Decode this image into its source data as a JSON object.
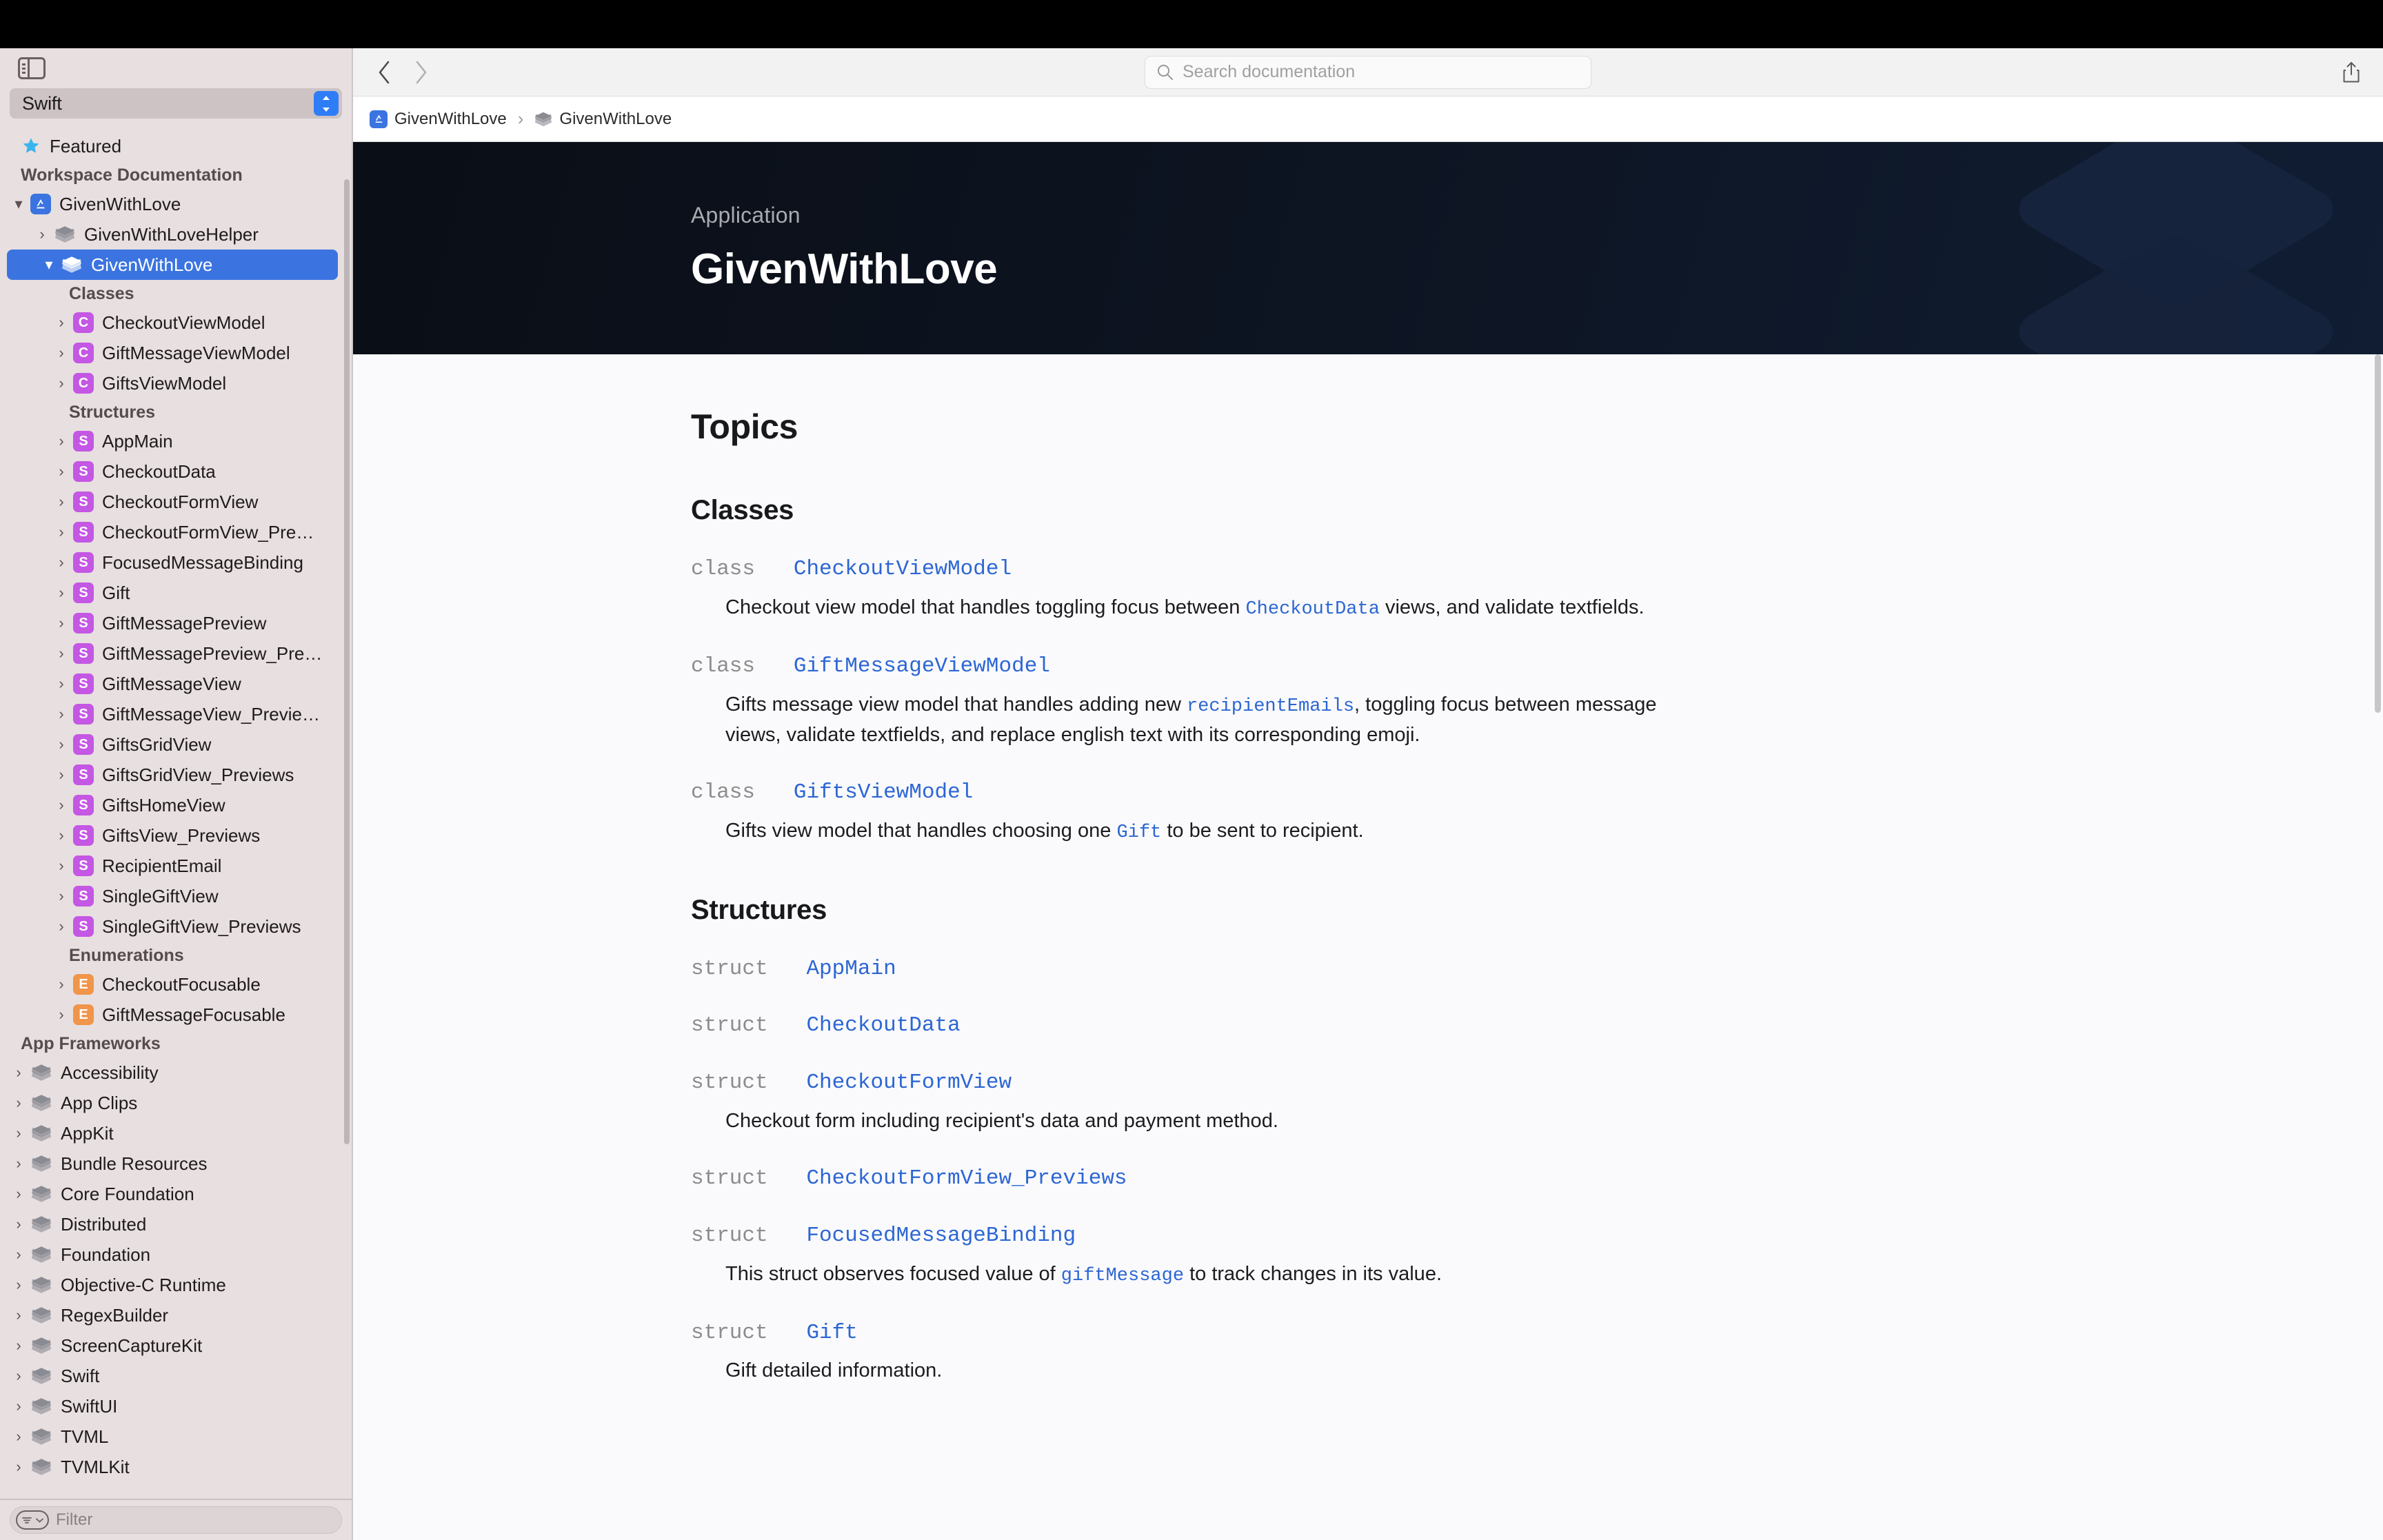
{
  "window": {
    "chrome_color": "#000000"
  },
  "sidebar": {
    "toggle_icon": "sidebar-toggle-icon",
    "language_selector": {
      "value": "Swift",
      "icon": "chevron-up-down-icon"
    },
    "featured": {
      "label": "Featured",
      "icon": "star-icon"
    },
    "groups": [
      {
        "header": "Workspace Documentation",
        "items": [
          {
            "label": "GivenWithLove",
            "icon": "app-icon",
            "disclosure": "expanded",
            "indent": 0
          },
          {
            "label": "GivenWithLoveHelper",
            "icon": "stack-icon",
            "disclosure": "collapsed",
            "indent": 1
          },
          {
            "label": "GivenWithLove",
            "icon": "stack-icon",
            "disclosure": "expanded",
            "indent": 1,
            "selected": true
          }
        ]
      }
    ],
    "subsections": [
      {
        "header": "Classes",
        "items": [
          {
            "label": "CheckoutViewModel",
            "badge": "C",
            "badge_kind": "c"
          },
          {
            "label": "GiftMessageViewModel",
            "badge": "C",
            "badge_kind": "c"
          },
          {
            "label": "GiftsViewModel",
            "badge": "C",
            "badge_kind": "c"
          }
        ]
      },
      {
        "header": "Structures",
        "items": [
          {
            "label": "AppMain",
            "badge": "S",
            "badge_kind": "s"
          },
          {
            "label": "CheckoutData",
            "badge": "S",
            "badge_kind": "s"
          },
          {
            "label": "CheckoutFormView",
            "badge": "S",
            "badge_kind": "s"
          },
          {
            "label": "CheckoutFormView_Pre…",
            "badge": "S",
            "badge_kind": "s"
          },
          {
            "label": "FocusedMessageBinding",
            "badge": "S",
            "badge_kind": "s"
          },
          {
            "label": "Gift",
            "badge": "S",
            "badge_kind": "s"
          },
          {
            "label": "GiftMessagePreview",
            "badge": "S",
            "badge_kind": "s"
          },
          {
            "label": "GiftMessagePreview_Pre…",
            "badge": "S",
            "badge_kind": "s"
          },
          {
            "label": "GiftMessageView",
            "badge": "S",
            "badge_kind": "s"
          },
          {
            "label": "GiftMessageView_Previe…",
            "badge": "S",
            "badge_kind": "s"
          },
          {
            "label": "GiftsGridView",
            "badge": "S",
            "badge_kind": "s"
          },
          {
            "label": "GiftsGridView_Previews",
            "badge": "S",
            "badge_kind": "s"
          },
          {
            "label": "GiftsHomeView",
            "badge": "S",
            "badge_kind": "s"
          },
          {
            "label": "GiftsView_Previews",
            "badge": "S",
            "badge_kind": "s"
          },
          {
            "label": "RecipientEmail",
            "badge": "S",
            "badge_kind": "s"
          },
          {
            "label": "SingleGiftView",
            "badge": "S",
            "badge_kind": "s"
          },
          {
            "label": "SingleGiftView_Previews",
            "badge": "S",
            "badge_kind": "s"
          }
        ]
      },
      {
        "header": "Enumerations",
        "items": [
          {
            "label": "CheckoutFocusable",
            "badge": "E",
            "badge_kind": "e"
          },
          {
            "label": "GiftMessageFocusable",
            "badge": "E",
            "badge_kind": "e"
          }
        ]
      }
    ],
    "frameworks": {
      "header": "App Frameworks",
      "items": [
        {
          "label": "Accessibility"
        },
        {
          "label": "App Clips"
        },
        {
          "label": "AppKit"
        },
        {
          "label": "Bundle Resources"
        },
        {
          "label": "Core Foundation"
        },
        {
          "label": "Distributed"
        },
        {
          "label": "Foundation"
        },
        {
          "label": "Objective-C Runtime"
        },
        {
          "label": "RegexBuilder"
        },
        {
          "label": "ScreenCaptureKit"
        },
        {
          "label": "Swift"
        },
        {
          "label": "SwiftUI"
        },
        {
          "label": "TVML"
        },
        {
          "label": "TVMLKit"
        }
      ]
    },
    "filter": {
      "placeholder": "Filter",
      "icon": "filter-pill-icon"
    }
  },
  "toolbar": {
    "back_icon": "chevron-left-icon",
    "forward_icon": "chevron-right-icon",
    "search": {
      "placeholder": "Search documentation",
      "icon": "search-icon"
    },
    "share_icon": "share-icon"
  },
  "breadcrumb": {
    "items": [
      {
        "label": "GivenWithLove",
        "icon": "app-icon"
      },
      {
        "label": "GivenWithLove",
        "icon": "stack-icon"
      }
    ],
    "separator": "›"
  },
  "hero": {
    "eyebrow": "Application",
    "title": "GivenWithLove",
    "decoration_icon": "stack-layers-icon",
    "gradient_from": "#0a0e16",
    "gradient_to": "#101d33"
  },
  "document": {
    "topics_heading": "Topics",
    "sections": [
      {
        "heading": "Classes",
        "entries": [
          {
            "keyword": "class",
            "name": "CheckoutViewModel",
            "abstract_parts": [
              {
                "t": "Checkout view model that handles toggling focus between ",
                "code": false
              },
              {
                "t": "CheckoutData",
                "code": true
              },
              {
                "t": " views, and validate textfields.",
                "code": false
              }
            ]
          },
          {
            "keyword": "class",
            "name": "GiftMessageViewModel",
            "abstract_parts": [
              {
                "t": "Gifts message view model that handles adding new ",
                "code": false
              },
              {
                "t": "recipientEmails",
                "code": true
              },
              {
                "t": ", toggling focus between message views, validate textfields, and replace english text with its corresponding emoji.",
                "code": false
              }
            ]
          },
          {
            "keyword": "class",
            "name": "GiftsViewModel",
            "abstract_parts": [
              {
                "t": "Gifts view model that handles choosing one ",
                "code": false
              },
              {
                "t": "Gift",
                "code": true
              },
              {
                "t": " to be sent to recipient.",
                "code": false
              }
            ]
          }
        ]
      },
      {
        "heading": "Structures",
        "entries": [
          {
            "keyword": "struct",
            "name": "AppMain",
            "abstract_parts": []
          },
          {
            "keyword": "struct",
            "name": "CheckoutData",
            "abstract_parts": []
          },
          {
            "keyword": "struct",
            "name": "CheckoutFormView",
            "abstract_parts": [
              {
                "t": "Checkout form including recipient's data and payment method.",
                "code": false
              }
            ]
          },
          {
            "keyword": "struct",
            "name": "CheckoutFormView_Previews",
            "abstract_parts": []
          },
          {
            "keyword": "struct",
            "name": "FocusedMessageBinding",
            "abstract_parts": [
              {
                "t": "This struct observes focused value of ",
                "code": false
              },
              {
                "t": "giftMessage",
                "code": true
              },
              {
                "t": " to track changes in its value.",
                "code": false
              }
            ]
          },
          {
            "keyword": "struct",
            "name": "Gift",
            "abstract_parts": [
              {
                "t": "Gift detailed information.",
                "code": false
              }
            ]
          }
        ]
      }
    ]
  },
  "colors": {
    "accent_blue": "#3b74e0",
    "link_blue": "#2c66d4",
    "badge_purple": "#c457e3",
    "badge_orange": "#f0954a",
    "sidebar_bg": "#e7dfe0",
    "doc_bg": "#fafafc"
  }
}
